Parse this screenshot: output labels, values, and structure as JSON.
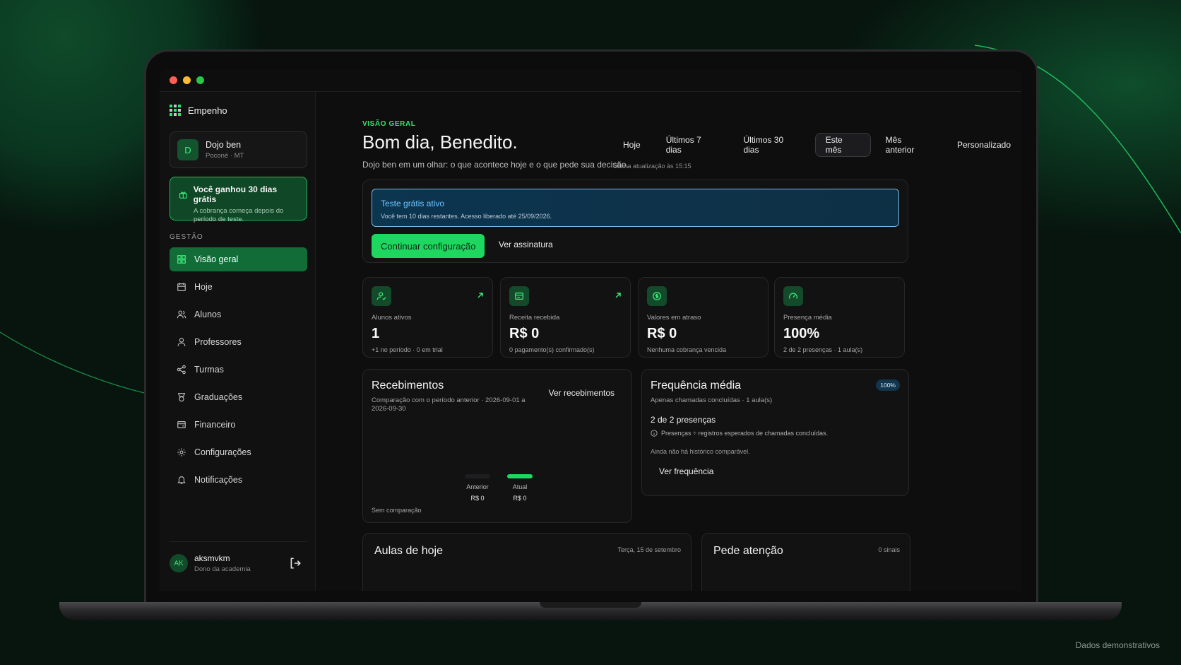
{
  "footnote": "Dados demonstrativos",
  "sidebar": {
    "brand": "Empenho",
    "org": {
      "initial": "D",
      "name": "Dojo ben",
      "location": "Poconé · MT"
    },
    "trial": {
      "title": "Você ganhou 30 dias grátis",
      "subtitle": "A cobrança começa depois do período de teste."
    },
    "section_label": "GESTÃO",
    "items": [
      {
        "label": "Visão geral",
        "icon": "grid-icon",
        "active": true
      },
      {
        "label": "Hoje",
        "icon": "calendar-icon"
      },
      {
        "label": "Alunos",
        "icon": "users-icon"
      },
      {
        "label": "Professores",
        "icon": "user-icon"
      },
      {
        "label": "Turmas",
        "icon": "share-icon"
      },
      {
        "label": "Graduações",
        "icon": "medal-icon"
      },
      {
        "label": "Financeiro",
        "icon": "wallet-icon"
      },
      {
        "label": "Configurações",
        "icon": "gear-icon"
      },
      {
        "label": "Notificações",
        "icon": "bell-icon"
      }
    ],
    "user": {
      "initials": "AK",
      "name": "aksmvkm",
      "role": "Dono da academia"
    }
  },
  "header": {
    "eyebrow": "VISÃO GERAL",
    "greeting": "Bom dia, Benedito.",
    "subtitle": "Dojo ben em um olhar: o que acontece hoje e o que pede sua decisão.",
    "updated": "Última atualização às 15:15",
    "ranges": [
      "Hoje",
      "Últimos 7 dias",
      "Últimos 30 dias",
      "Este mês",
      "Mês anterior",
      "Personalizado"
    ],
    "active_range": "Este mês"
  },
  "trial_banner": {
    "title": "Teste grátis ativo",
    "subtitle": "Você tem 10 dias restantes. Acesso liberado até 25/09/2026.",
    "primary_button": "Continuar configuração",
    "link": "Ver assinatura"
  },
  "stats": [
    {
      "label": "Alunos ativos",
      "value": "1",
      "sub": "+1 no período · 0 em trial",
      "icon": "user-check-icon"
    },
    {
      "label": "Receita recebida",
      "value": "R$ 0",
      "sub": "0 pagamento(s) confirmado(s)",
      "icon": "wallet-icon"
    },
    {
      "label": "Valores em atraso",
      "value": "R$ 0",
      "sub": "Nenhuma cobrança vencida",
      "icon": "dollar-icon"
    },
    {
      "label": "Presença média",
      "value": "100%",
      "sub": "2 de 2 presenças · 1 aula(s)",
      "icon": "gauge-icon"
    }
  ],
  "recebimentos": {
    "title": "Recebimentos",
    "subtitle": "Comparação com o período anterior · 2026-09-01 a 2026-09-30",
    "link": "Ver recebimentos",
    "bars": [
      {
        "label": "Anterior",
        "value": "R$ 0"
      },
      {
        "label": "Atual",
        "value": "R$ 0"
      }
    ],
    "footer": "Sem comparação"
  },
  "frequencia": {
    "title": "Frequência média",
    "subtitle": "Apenas chamadas concluídas · 1 aula(s)",
    "badge": "100%",
    "main": "2 de 2 presenças",
    "note": "Presenças ÷ registros esperados de chamadas concluídas.",
    "empty": "Ainda não há histórico comparável.",
    "link": "Ver frequência"
  },
  "aulas": {
    "title": "Aulas de hoje",
    "date": "Terça, 15 de setembro"
  },
  "atencao": {
    "title": "Pede atenção",
    "count": "0 sinais"
  },
  "colors": {
    "accent": "#1ed75f",
    "info": "#6fc6ff",
    "background": "#0e0e0f"
  }
}
